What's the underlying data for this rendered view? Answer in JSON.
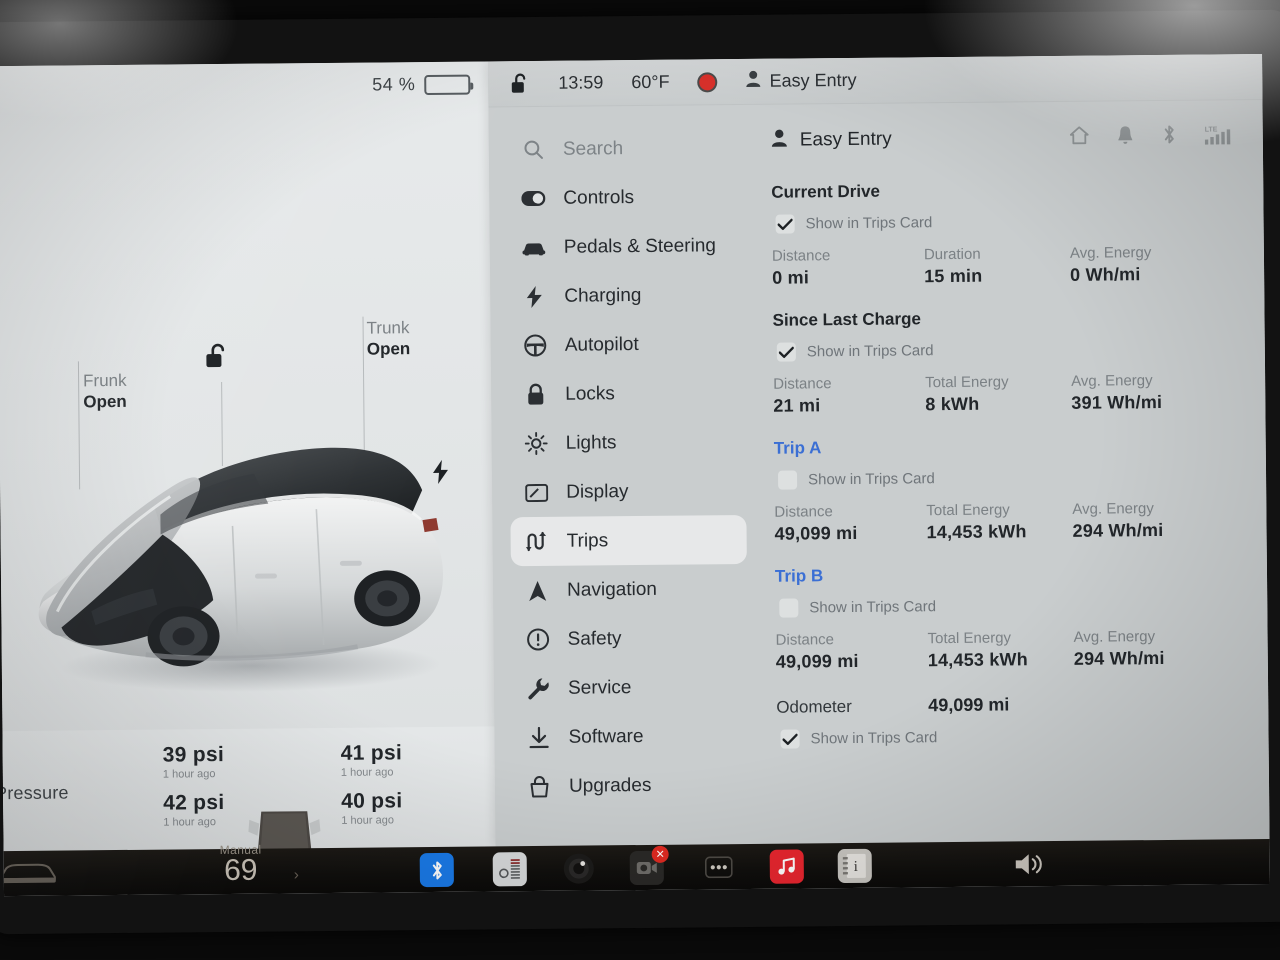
{
  "vehicle_panel": {
    "battery_percent": "54 %",
    "battery_level": 54,
    "callouts": [
      {
        "title": "Frunk",
        "value": "Open"
      },
      {
        "title": "Trunk",
        "value": "Open"
      }
    ],
    "unlock_icon": "unlock-icon",
    "charge_port_icon": "charge-bolt-icon",
    "tire_pressure": {
      "title": "Pressure",
      "tires": [
        {
          "position": "front-left",
          "value": "39 psi",
          "updated": "1 hour ago"
        },
        {
          "position": "front-right",
          "value": "41 psi",
          "updated": "1 hour ago"
        },
        {
          "position": "rear-left",
          "value": "42 psi",
          "updated": "1 hour ago"
        },
        {
          "position": "rear-right",
          "value": "40 psi",
          "updated": "1 hour ago"
        }
      ]
    }
  },
  "system_bar": {
    "lock_icon": "unlock-icon",
    "time": "13:59",
    "temperature": "60°F",
    "record_icon": "record-dot-icon",
    "profile_icon": "person-icon",
    "profile": "Easy Entry"
  },
  "settings": {
    "search_placeholder": "Search",
    "menu": [
      {
        "label": "Search",
        "icon": "search-icon",
        "active": false,
        "dim": true
      },
      {
        "label": "Controls",
        "icon": "toggle-icon",
        "active": false,
        "dim": false
      },
      {
        "label": "Pedals & Steering",
        "icon": "car-front-icon",
        "active": false,
        "dim": false
      },
      {
        "label": "Charging",
        "icon": "bolt-icon",
        "active": false,
        "dim": false
      },
      {
        "label": "Autopilot",
        "icon": "steering-icon",
        "active": false,
        "dim": false
      },
      {
        "label": "Locks",
        "icon": "lock-icon",
        "active": false,
        "dim": false
      },
      {
        "label": "Lights",
        "icon": "sun-icon",
        "active": false,
        "dim": false
      },
      {
        "label": "Display",
        "icon": "display-icon",
        "active": false,
        "dim": false
      },
      {
        "label": "Trips",
        "icon": "trips-icon",
        "active": true,
        "dim": false
      },
      {
        "label": "Navigation",
        "icon": "navigation-icon",
        "active": false,
        "dim": false
      },
      {
        "label": "Safety",
        "icon": "alert-circle-icon",
        "active": false,
        "dim": false
      },
      {
        "label": "Service",
        "icon": "wrench-icon",
        "active": false,
        "dim": false
      },
      {
        "label": "Software",
        "icon": "download-icon",
        "active": false,
        "dim": false
      },
      {
        "label": "Upgrades",
        "icon": "bag-icon",
        "active": false,
        "dim": false
      }
    ],
    "header": {
      "profile": "Easy Entry",
      "status_icons": [
        "home-icon",
        "bell-icon",
        "bluetooth-icon",
        "lte-signal-icon"
      ],
      "network_label": "LTE"
    },
    "show_in_trips_label": "Show in Trips Card",
    "sections": [
      {
        "title": "Current Drive",
        "is_link": false,
        "checked": true,
        "stats": [
          {
            "label": "Distance",
            "value": "0 mi"
          },
          {
            "label": "Duration",
            "value": "15 min"
          },
          {
            "label": "Avg. Energy",
            "value": "0 Wh/mi"
          }
        ]
      },
      {
        "title": "Since Last Charge",
        "is_link": false,
        "checked": true,
        "stats": [
          {
            "label": "Distance",
            "value": "21 mi"
          },
          {
            "label": "Total Energy",
            "value": "8 kWh"
          },
          {
            "label": "Avg. Energy",
            "value": "391 Wh/mi"
          }
        ]
      },
      {
        "title": "Trip A",
        "is_link": true,
        "checked": false,
        "stats": [
          {
            "label": "Distance",
            "value": "49,099 mi"
          },
          {
            "label": "Total Energy",
            "value": "14,453 kWh"
          },
          {
            "label": "Avg. Energy",
            "value": "294 Wh/mi"
          }
        ]
      },
      {
        "title": "Trip B",
        "is_link": true,
        "checked": false,
        "stats": [
          {
            "label": "Distance",
            "value": "49,099 mi"
          },
          {
            "label": "Total Energy",
            "value": "14,453 kWh"
          },
          {
            "label": "Avg. Energy",
            "value": "294 Wh/mi"
          }
        ]
      }
    ],
    "odometer": {
      "label": "Odometer",
      "value": "49,099 mi",
      "checked": true
    }
  },
  "dock": {
    "car_icon": "car-icon",
    "climate_mode": "Manual",
    "temperature": "69",
    "apps": [
      {
        "name": "bluetooth-app-icon"
      },
      {
        "name": "climate-vent-icon"
      },
      {
        "name": "camera-lens-icon"
      },
      {
        "name": "dashcam-icon"
      },
      {
        "name": "more-icon"
      },
      {
        "name": "music-icon"
      },
      {
        "name": "manual-icon"
      }
    ],
    "volume_icon": "volume-icon"
  },
  "colors": {
    "accent_link": "#3b6fd4",
    "record_red": "#d8302a",
    "bluetooth_blue": "#1a7ae8",
    "music_red": "#e8262f",
    "panel_bg": "#c9cdce",
    "left_bg": "#e4e7e8"
  }
}
